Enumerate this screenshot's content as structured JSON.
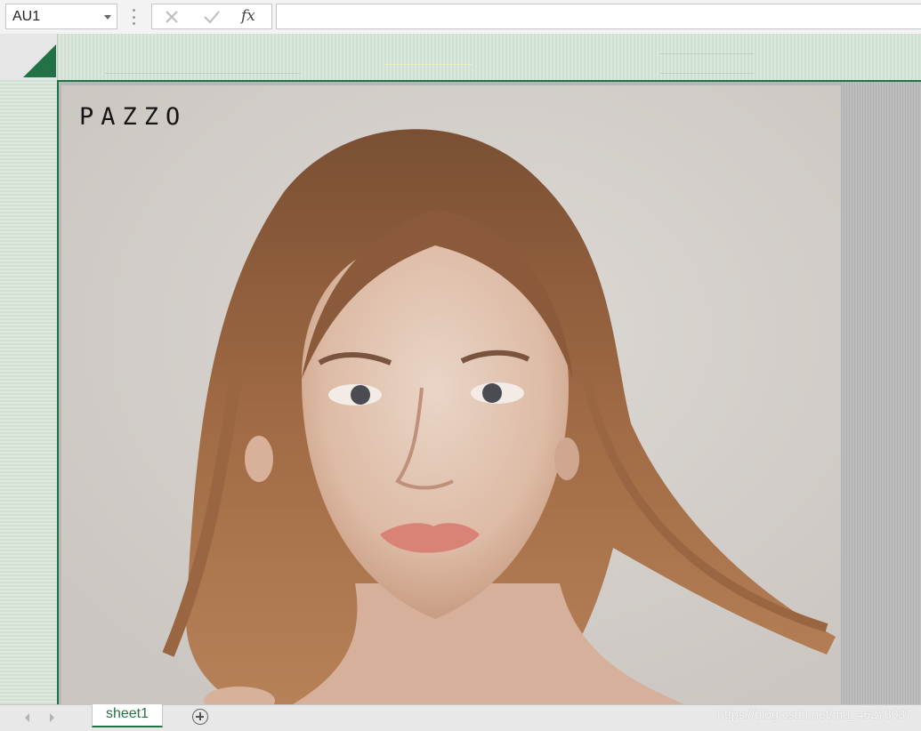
{
  "formula_bar": {
    "name_box_value": "AU1",
    "cancel_icon": "close-icon",
    "enter_icon": "check-icon",
    "fx_label": "fx",
    "formula_value": ""
  },
  "picture": {
    "logo_text": "PAZZO"
  },
  "sheet_tabs": {
    "active_tab": "sheet1"
  },
  "watermark": "https://blog.csdn.net/m0_46278037",
  "colors": {
    "accent": "#217346",
    "header_band": "#cfe0d3"
  }
}
